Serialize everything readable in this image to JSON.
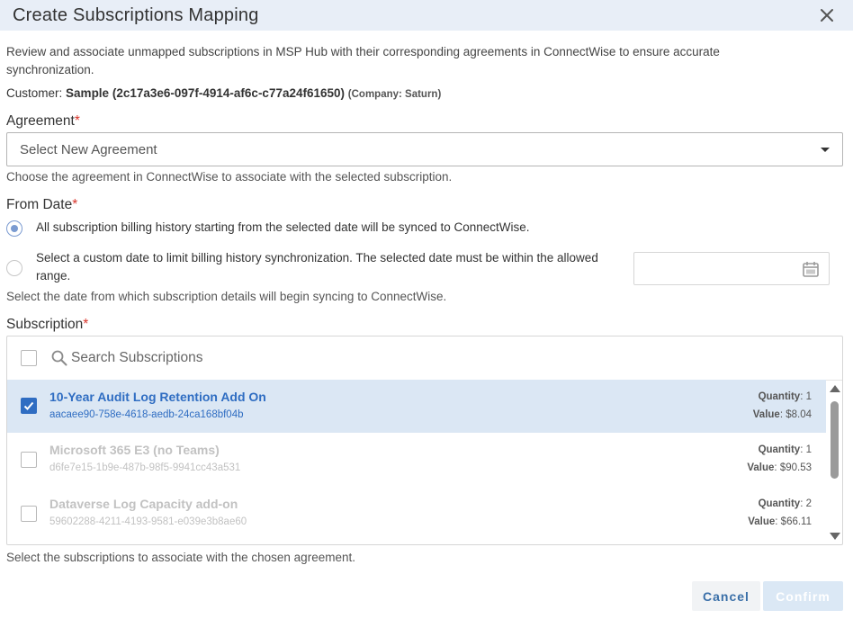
{
  "dialog": {
    "title": "Create Subscriptions Mapping",
    "description": "Review and associate unmapped subscriptions in MSP Hub with their corresponding agreements in ConnectWise to ensure accurate synchronization."
  },
  "customer": {
    "label": "Customer:",
    "name": "Sample (2c17a3e6-097f-4914-af6c-c77a24f61650)",
    "company": "(Company: Saturn)"
  },
  "agreement": {
    "label": "Agreement",
    "required_mark": "*",
    "placeholder": "Select New Agreement",
    "help": "Choose the agreement in ConnectWise to associate with the selected subscription."
  },
  "from_date": {
    "label": "From Date",
    "required_mark": "*",
    "option_all": "All subscription billing history starting from the selected date will be synced to ConnectWise.",
    "option_custom_line1": "Select a custom date to limit billing history synchronization. The selected date must be within the allowed",
    "option_custom_line2": "range.",
    "selected_option": "all",
    "date_value": "",
    "help": "Select the date from which subscription details will begin syncing to ConnectWise."
  },
  "subscription": {
    "label": "Subscription",
    "required_mark": "*",
    "search_placeholder": "Search Subscriptions",
    "quantity_label": "Quantity",
    "value_label": "Value",
    "items": [
      {
        "name": "10-Year Audit Log Retention Add On",
        "id": "aacaee90-758e-4618-aedb-24ca168bf04b",
        "quantity": "1",
        "value": "$8.04",
        "selected": true
      },
      {
        "name": "Microsoft 365 E3 (no Teams)",
        "id": "d6fe7e15-1b9e-487b-98f5-9941cc43a531",
        "quantity": "1",
        "value": "$90.53",
        "selected": false
      },
      {
        "name": "Dataverse Log Capacity add-on",
        "id": "59602288-4211-4193-9581-e039e3b8ae60",
        "quantity": "2",
        "value": "$66.11",
        "selected": false
      }
    ],
    "help": "Select the subscriptions to associate with the chosen agreement."
  },
  "buttons": {
    "cancel": "Cancel",
    "confirm": "Confirm"
  },
  "colors": {
    "header_bg": "#e8eef7",
    "accent": "#2f6dc2",
    "required": "#d9352b",
    "selected_row": "#dbe7f4"
  }
}
